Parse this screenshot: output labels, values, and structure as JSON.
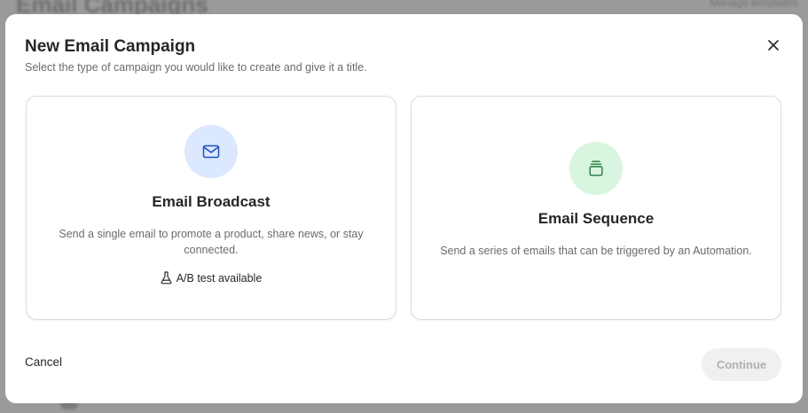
{
  "background": {
    "page_title": "Email Campaigns",
    "right_action": "Manage templates"
  },
  "modal": {
    "title": "New Email Campaign",
    "subtitle": "Select the type of campaign you would like to create and give it a title.",
    "close_icon": "close-icon",
    "options": [
      {
        "title": "Email Broadcast",
        "description": "Send a single email to promote a product, share news, or stay connected.",
        "badge": "A/B test available",
        "icon": "envelope-icon",
        "icon_bg": "#dbe8fd",
        "icon_color": "#1f4fbf"
      },
      {
        "title": "Email Sequence",
        "description": "Send a series of emails that can be triggered by an Automation.",
        "icon": "stack-icon",
        "icon_bg": "#d8f5e0",
        "icon_color": "#1f7a3d"
      }
    ],
    "cancel_label": "Cancel",
    "continue_label": "Continue",
    "continue_disabled": true
  }
}
